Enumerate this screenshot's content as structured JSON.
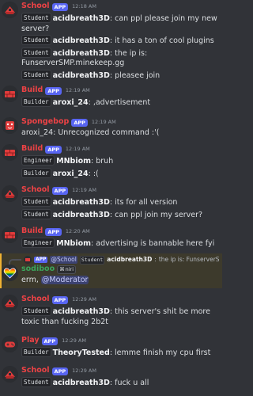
{
  "colors": {
    "school": "#ed4245",
    "build": "#ed4245",
    "spongebop": "#ed4245",
    "play": "#ed4245",
    "sodiboo": "#3ba55c",
    "app_badge": "#5865f2",
    "background": "#313338",
    "highlight": "#3d3a2c"
  },
  "app_badge": "APP",
  "messages": [
    {
      "author": "School",
      "time": "12:18 AM",
      "avatar_icon": "red-building-icon",
      "lines": [
        {
          "role": "Student",
          "name": "acidbreath3D",
          "text": "can ppl please join my new server?"
        },
        {
          "role": "Student",
          "name": "acidbreath3D",
          "text": "it has a ton of cool plugins"
        },
        {
          "role": "Student",
          "name": "acidbreath3D",
          "text": "the ip is: FunserverSMP.minekeep.gg"
        },
        {
          "role": "Student",
          "name": "acidbreath3D",
          "text": "pleasee join"
        }
      ]
    },
    {
      "author": "Build",
      "time": "12:19 AM",
      "avatar_icon": "red-brick-icon",
      "lines": [
        {
          "role": "Builder",
          "name": "aroxi_24",
          "text": ",advertisement"
        }
      ]
    },
    {
      "author": "Spongebop",
      "time": "12:19 AM",
      "avatar_icon": "red-sponge-icon",
      "lines": [
        {
          "role": "",
          "name": "",
          "text": "aroxi_24: Unrecognized command :'("
        }
      ]
    },
    {
      "author": "Build",
      "time": "12:19 AM",
      "avatar_icon": "red-brick-icon",
      "lines": [
        {
          "role": "Engineer",
          "name": "MNbiom",
          "text": "bruh"
        },
        {
          "role": "Builder",
          "name": "aroxi_24",
          "text": ":("
        }
      ]
    },
    {
      "author": "School",
      "time": "12:19 AM",
      "avatar_icon": "red-building-icon",
      "lines": [
        {
          "role": "Student",
          "name": "acidbreath3D",
          "text": "its for all version"
        },
        {
          "role": "Student",
          "name": "acidbreath3D",
          "text": "can ppl join my server?"
        }
      ]
    },
    {
      "author": "Build",
      "time": "12:20 AM",
      "avatar_icon": "red-brick-icon",
      "lines": [
        {
          "role": "Engineer",
          "name": "MNbiom",
          "text": "advertising is bannable here fyi"
        }
      ]
    },
    {
      "author": "sodiboo",
      "time": "",
      "avatar_icon": "rainbow-heart-icon",
      "reply": {
        "mention": "@School",
        "role": "Student",
        "name": "acidbreath3D",
        "text": "the ip is: FunserverS..."
      },
      "tag": "niri",
      "lines": [
        {
          "role": "",
          "name": "",
          "text": "erm,",
          "mention": "@Moderator"
        }
      ]
    },
    {
      "author": "School",
      "time": "12:29 AM",
      "avatar_icon": "red-building-icon",
      "lines": [
        {
          "role": "Student",
          "name": "acidbreath3D",
          "text": "this server's shit be more toxic than fucking 2b2t"
        }
      ]
    },
    {
      "author": "Play",
      "time": "12:29 AM",
      "avatar_icon": "red-controller-icon",
      "lines": [
        {
          "role": "Builder",
          "name": "TheoryTested",
          "text": "lemme finish my cpu first"
        }
      ]
    },
    {
      "author": "School",
      "time": "12:29 AM",
      "avatar_icon": "red-building-icon",
      "lines": [
        {
          "role": "Student",
          "name": "acidbreath3D",
          "text": "fuck u all"
        }
      ]
    }
  ]
}
